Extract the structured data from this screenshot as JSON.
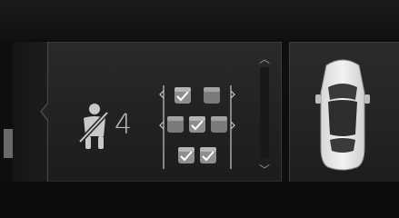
{
  "seatbelt": {
    "icon": "seatbelt-unbuckled-icon",
    "count": "4"
  },
  "seats": {
    "rows": [
      {
        "seats": [
          {
            "icon": "seat-occupied-icon",
            "occupied": true
          },
          {
            "icon": "seat-empty-icon",
            "occupied": false
          }
        ]
      },
      {
        "seats": [
          {
            "icon": "seat-empty-icon",
            "occupied": false
          },
          {
            "icon": "seat-occupied-icon",
            "occupied": true
          },
          {
            "icon": "seat-empty-icon",
            "occupied": false
          }
        ]
      },
      {
        "seats": [
          {
            "icon": "seat-occupied-icon",
            "occupied": true
          },
          {
            "icon": "seat-occupied-icon",
            "occupied": true
          }
        ]
      }
    ]
  },
  "scroll": {
    "up_icon": "chevron-up-icon",
    "down_icon": "chevron-down-icon",
    "up_glyph": "︿",
    "down_glyph": "﹀"
  },
  "vehicle": {
    "icon": "car-top-view-icon"
  },
  "colors": {
    "icon": "#c9c9cb",
    "panel": "#252527",
    "background": "#0e0e0f"
  }
}
